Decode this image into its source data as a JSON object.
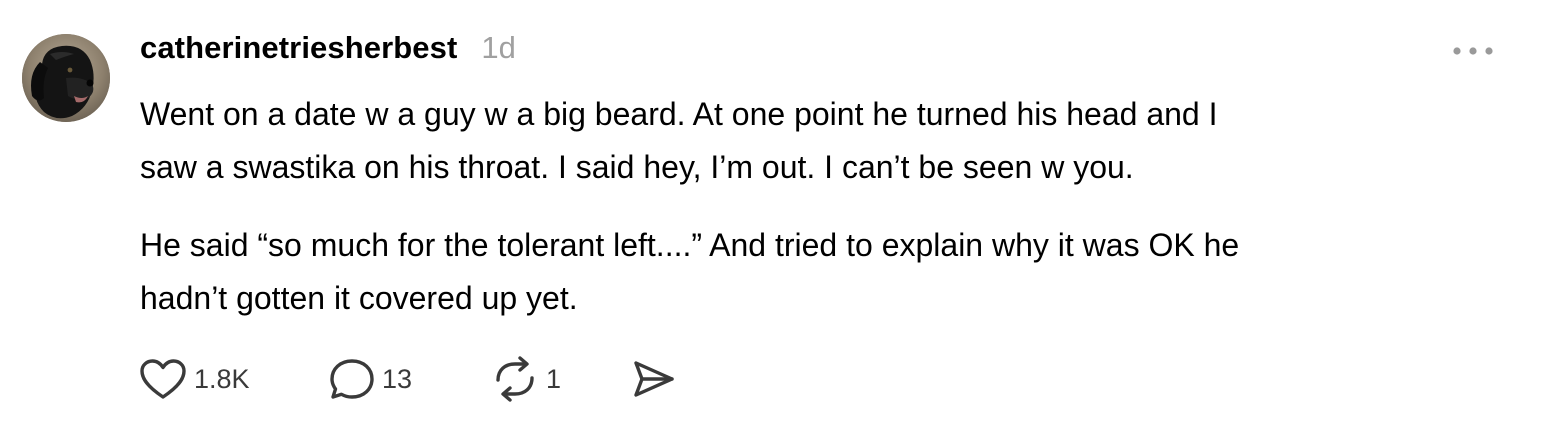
{
  "post": {
    "username": "catherinetriesherbest",
    "timestamp": "1d",
    "paragraphs": [
      "Went on a date w a guy w a big beard. At one point he turned his head and I",
      "saw a swastika on his throat. I said hey, I’m out. I can’t be seen w you.",
      "He said “so much for the tolerant left....” And tried to explain why it was OK he",
      "hadn’t gotten it covered up yet."
    ],
    "actions": {
      "likes": "1.8K",
      "replies": "13",
      "reposts": "1"
    }
  },
  "icons": {
    "avatar": "dog-photo-avatar",
    "more": "more-horizontal-icon",
    "like": "heart-icon",
    "reply": "comment-bubble-icon",
    "repost": "repost-icon",
    "share": "send-icon"
  },
  "colors": {
    "text": "#000000",
    "muted": "#a0a0a0",
    "icon": "#3a3a3a"
  }
}
